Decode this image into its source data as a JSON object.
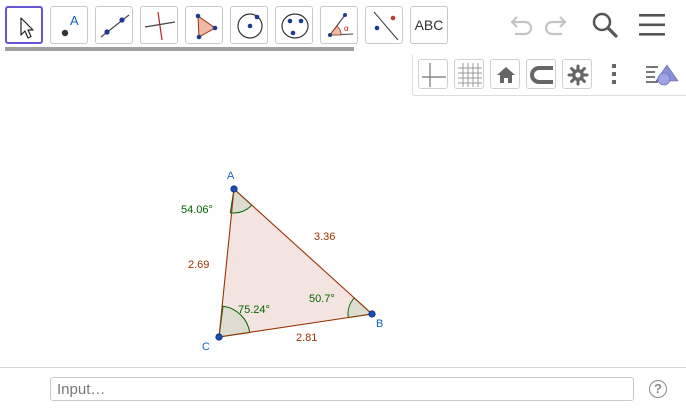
{
  "toolbar": {
    "tools": [
      {
        "name": "move-tool",
        "text": ""
      },
      {
        "name": "point-tool",
        "text": "A"
      },
      {
        "name": "line-tool",
        "text": ""
      },
      {
        "name": "perpendicular-line-tool",
        "text": ""
      },
      {
        "name": "polygon-tool",
        "text": ""
      },
      {
        "name": "circle-center-point-tool",
        "text": ""
      },
      {
        "name": "conic-tool",
        "text": ""
      },
      {
        "name": "angle-tool",
        "text": ""
      },
      {
        "name": "reflect-tool",
        "text": ""
      },
      {
        "name": "text-tool",
        "text": "ABC"
      }
    ],
    "active_tool": "move-tool",
    "right_icons": [
      "undo-icon",
      "redo-icon",
      "search-icon",
      "menu-icon"
    ]
  },
  "stylebar": {
    "icons": [
      "axes-icon",
      "grid-icon",
      "home-icon",
      "point-capturing-icon",
      "settings-icon",
      "more-icon",
      "style-bar-toggle-icon"
    ]
  },
  "canvas": {
    "points": [
      {
        "label": "A",
        "color": "#1565c0"
      },
      {
        "label": "B",
        "color": "#1565c0"
      },
      {
        "label": "C",
        "color": "#1565c0"
      }
    ],
    "segments": [
      {
        "label": "3.36",
        "color": "#993300"
      },
      {
        "label": "2.81",
        "color": "#993300"
      },
      {
        "label": "2.69",
        "color": "#993300"
      }
    ],
    "angles": [
      {
        "vertex": "A",
        "label": "54.06°",
        "color": "#006400"
      },
      {
        "vertex": "B",
        "label": "50.7°",
        "color": "#006400"
      },
      {
        "vertex": "C",
        "label": "75.24°",
        "color": "#006400"
      }
    ],
    "polygon_fill": "#f3e3e0",
    "polygon_stroke": "#993300"
  },
  "input": {
    "placeholder": "Input…",
    "help_label": "?"
  }
}
